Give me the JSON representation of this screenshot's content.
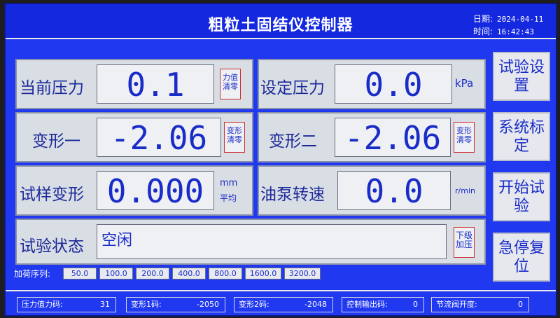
{
  "title": "粗粒土固结仪控制器",
  "date_label": "日期:",
  "date_value": "2024-04-11",
  "time_label": "时间:",
  "time_value": "16:42:43",
  "rows": {
    "current_pressure": {
      "label": "当前压力",
      "value": "0.1",
      "btn": "力值清零"
    },
    "set_pressure": {
      "label": "设定压力",
      "value": "0.0",
      "unit": "kPa"
    },
    "deform1": {
      "label": "变形一",
      "value": "-2.06",
      "btn": "变形清零"
    },
    "deform2": {
      "label": "变形二",
      "value": "-2.06",
      "btn": "变形清零"
    },
    "sample_deform": {
      "label": "试样变形",
      "value": "0.000",
      "unit_top": "mm",
      "unit_bottom": "平均"
    },
    "pump_speed": {
      "label": "油泵转速",
      "value": "0.0",
      "unit": "r/min"
    },
    "test_state": {
      "label": "试验状态",
      "value": "空闲",
      "btn": "下级加压"
    }
  },
  "side_buttons": {
    "test_setup": "试验设置",
    "system_calib": "系统标定",
    "start_test": "开始试验",
    "emergency_reset": "急停复位"
  },
  "load_sequence": {
    "label": "加荷序列:",
    "items": [
      "50.0",
      "100.0",
      "200.0",
      "400.0",
      "800.0",
      "1600.0",
      "3200.0"
    ]
  },
  "status": {
    "pressure_code_label": "压力值力码:",
    "pressure_code": "31",
    "deform1_code_label": "变形1码:",
    "deform1_code": "-2050",
    "deform2_code_label": "变形2码:",
    "deform2_code": "-2048",
    "control_out_label": "控制输出码:",
    "control_out": "0",
    "throttle_label": "节流阀开度:",
    "throttle": "0"
  }
}
